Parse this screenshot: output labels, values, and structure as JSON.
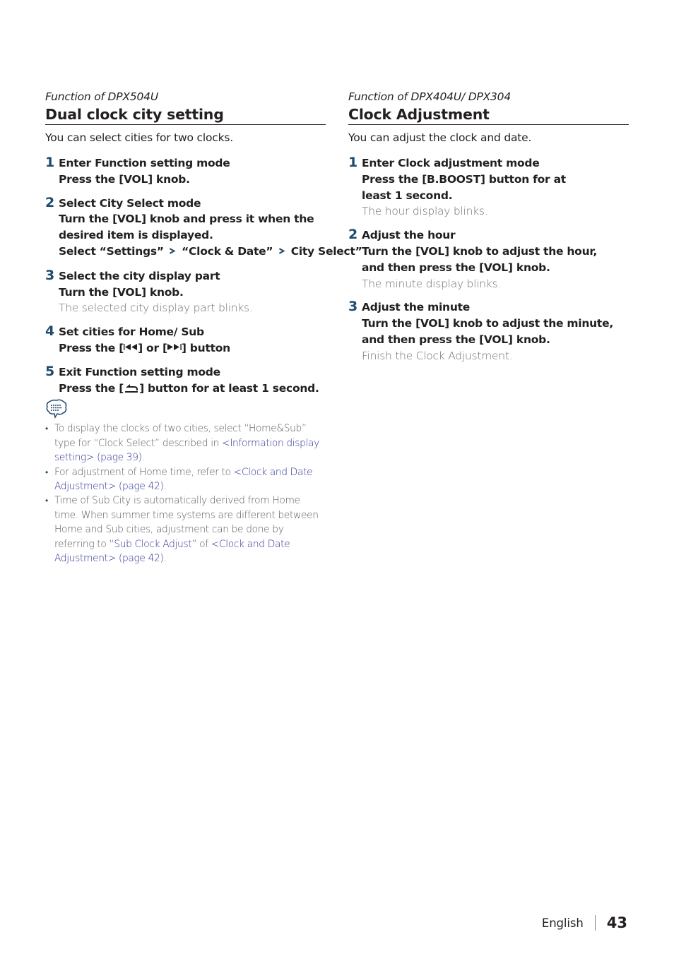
{
  "left": {
    "function_of": "Function of DPX504U",
    "title": "Dual clock city setting",
    "intro": "You can select cities for two clocks.",
    "steps": [
      {
        "num": "1",
        "title": "Enter Function setting mode",
        "action": "Press the [VOL] knob."
      },
      {
        "num": "2",
        "title": "Select City Select mode",
        "action": "Turn the [VOL] knob and press it when the desired item is displayed.",
        "path": [
          "Select “Settings”",
          "“Clock & Date”",
          "City Select”"
        ]
      },
      {
        "num": "3",
        "title": "Select the city display part",
        "action": "Turn the [VOL] knob.",
        "result": "The selected city display part blinks."
      },
      {
        "num": "4",
        "title": "Set cities for Home/ Sub",
        "action_pre": "Press the [",
        "prev_symbol": "I◀◀",
        "action_mid": "] or [",
        "next_symbol": "▶▶I",
        "action_post": "] button"
      },
      {
        "num": "5",
        "title": "Exit Function setting mode",
        "action_pre": "Press the [",
        "action_post": "] button for at least 1 second."
      }
    ],
    "path_separator": ">",
    "note_icon": "note-speech-bubble-icon",
    "notes": [
      {
        "text1": "To display the clocks of two cities, select “Home&Sub” type for “Clock Select” described in ",
        "link1": "<Information display setting> (page 39)",
        "text2": "."
      },
      {
        "text1": "For adjustment of Home time, refer to ",
        "link1": "<Clock and Date Adjustment> (page 42)",
        "text2": "."
      },
      {
        "text1": "Time of Sub City is automatically derived from Home time. When summer time systems are different between Home and Sub cities, adjustment can be done by referring to ",
        "link1": "“Sub Clock Adjust”",
        "text2": " of ",
        "link2": "<Clock and Date Adjustment> (page 42)",
        "text3": "."
      }
    ]
  },
  "right": {
    "function_of": "Function of DPX404U/ DPX304",
    "title": "Clock Adjustment",
    "intro": "You can adjust the clock and date.",
    "steps": [
      {
        "num": "1",
        "title": "Enter Clock adjustment mode",
        "action": "Press the [B.BOOST] button for at least 1 second.",
        "result": "The hour display blinks."
      },
      {
        "num": "2",
        "title": "Adjust the hour",
        "action": "Turn the [VOL] knob to adjust the hour, and then press the [VOL] knob.",
        "result": "The minute display blinks."
      },
      {
        "num": "3",
        "title": "Adjust the minute",
        "action": "Turn the [VOL] knob to adjust the minute, and then press the [VOL] knob.",
        "result": "Finish the Clock Adjustment."
      }
    ]
  },
  "footer": {
    "language": "English",
    "page_number": "43"
  },
  "colors": {
    "step_number": "#1e4b6e",
    "link": "#2e3192",
    "text": "#231f20",
    "muted": "#6d6e71"
  }
}
